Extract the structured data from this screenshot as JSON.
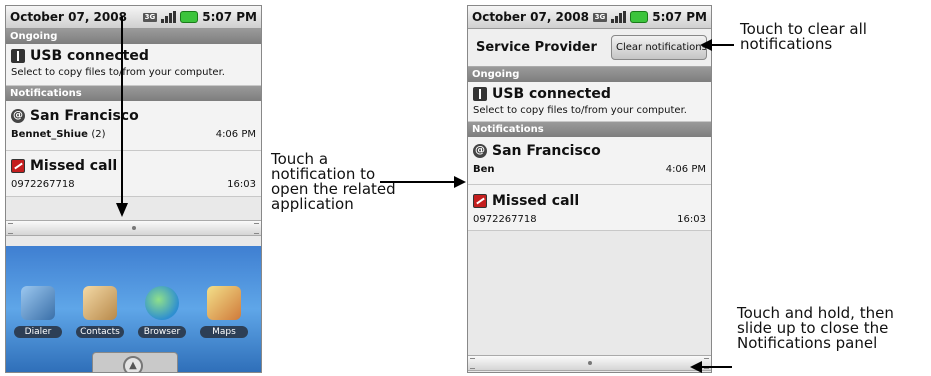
{
  "left_phone": {
    "status": {
      "date": "October 07, 2008",
      "network": "3G",
      "time": "5:07 PM"
    },
    "ongoing_label": "Ongoing",
    "usb": {
      "title": "USB connected",
      "subtitle": "Select to copy files to/from your computer."
    },
    "notifications_label": "Notifications",
    "sf": {
      "title": "San Francisco",
      "sender": "Bennet_Shiue",
      "count": "(2)",
      "time": "4:06 PM"
    },
    "missed": {
      "title": "Missed call",
      "number": "0972267718",
      "time": "16:03"
    },
    "apps": [
      "Dialer",
      "Contacts",
      "Browser",
      "Maps"
    ]
  },
  "right_phone": {
    "status": {
      "date": "October 07, 2008",
      "network": "3G",
      "time": "5:07 PM"
    },
    "provider": "Service Provider",
    "clear_button": "Clear notifications",
    "ongoing_label": "Ongoing",
    "usb": {
      "title": "USB connected",
      "subtitle": "Select to copy files to/from your computer."
    },
    "notifications_label": "Notifications",
    "sf": {
      "title": "San Francisco",
      "sender": "Ben",
      "time": "4:06 PM"
    },
    "missed": {
      "title": "Missed call",
      "number": "0972267718",
      "time": "16:03"
    }
  },
  "callouts": {
    "touch_notification": [
      "Touch a",
      "notification to",
      "open the related",
      "application"
    ],
    "clear_all": [
      "Touch to clear all",
      "notifications"
    ],
    "close_panel": [
      "Touch and hold, then",
      "slide up to close the",
      "Notifications panel"
    ]
  },
  "colors": {
    "battery": "#3cc43c",
    "section_header": "#8a8a8a",
    "home_bg": "#4a8fdd"
  }
}
